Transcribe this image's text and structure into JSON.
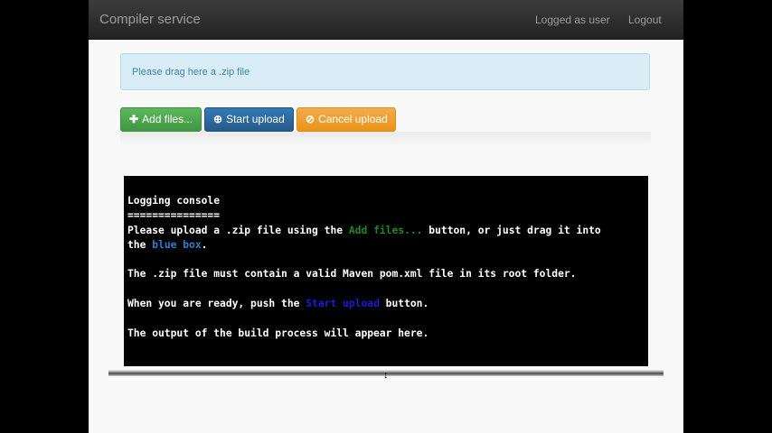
{
  "navbar": {
    "brand": "Compiler service",
    "logged_label": "Logged as user",
    "logout_label": "Logout"
  },
  "dropzone": {
    "text": "Please drag here a .zip file"
  },
  "buttons": {
    "add_files": {
      "icon": "plus-icon",
      "label": "Add files..."
    },
    "start_upload": {
      "icon": "upload-circle-icon",
      "label": "Start upload"
    },
    "cancel_upload": {
      "icon": "ban-circle-icon",
      "label": "Cancel upload"
    }
  },
  "progress": {
    "value": 0
  },
  "console": {
    "title": "Logging console",
    "underline": "===============",
    "line1_pre": "Please upload a .zip file using the ",
    "line1_link": "Add files...",
    "line1_post": " button, or just drag it into",
    "line2_pre": "the ",
    "line2_link": "blue box",
    "line2_post": ".",
    "line3": "The .zip file must contain a valid Maven pom.xml file in its root folder.",
    "line4_pre": "When you are ready, push the ",
    "line4_link": "Start upload",
    "line4_post": " button.",
    "line5": "The output of the build process will appear here."
  },
  "colors": {
    "add_green": "#5cb85c",
    "start_blue": "#337ab7",
    "cancel_orange": "#f0ad4e",
    "dropzone_bg": "#d9edf7",
    "console_bg": "#000000"
  }
}
